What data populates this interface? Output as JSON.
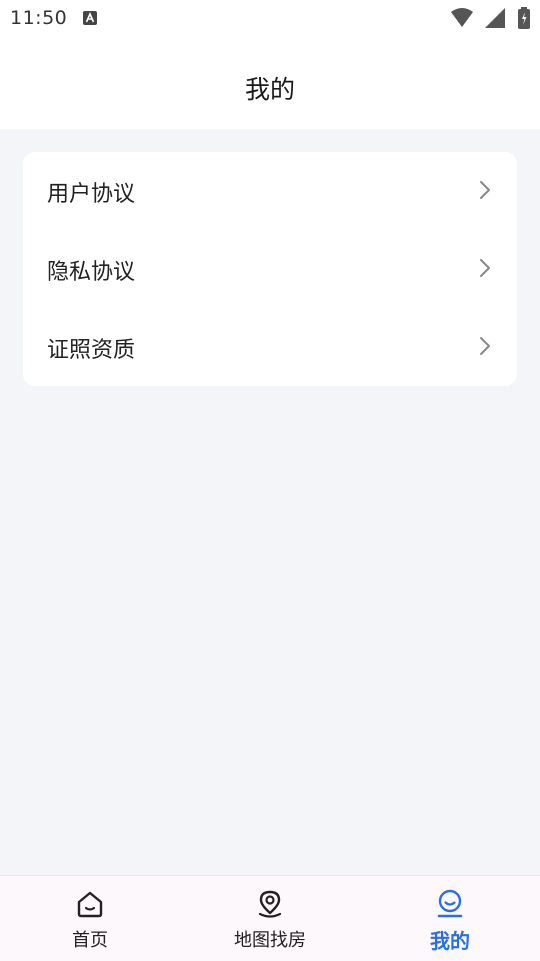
{
  "status_bar": {
    "time": "11:50"
  },
  "header": {
    "title": "我的"
  },
  "menu": {
    "items": [
      {
        "label": "用户协议",
        "icon": "chevron-right-icon"
      },
      {
        "label": "隐私协议",
        "icon": "chevron-right-icon"
      },
      {
        "label": "证照资质",
        "icon": "chevron-right-icon"
      }
    ]
  },
  "tab_bar": {
    "tabs": [
      {
        "label": "首页",
        "icon": "home-icon",
        "active": false
      },
      {
        "label": "地图找房",
        "icon": "map-pin-icon",
        "active": false
      },
      {
        "label": "我的",
        "icon": "profile-icon",
        "active": true
      }
    ],
    "active_color": "#2a6fe0",
    "inactive_color": "#222222"
  }
}
